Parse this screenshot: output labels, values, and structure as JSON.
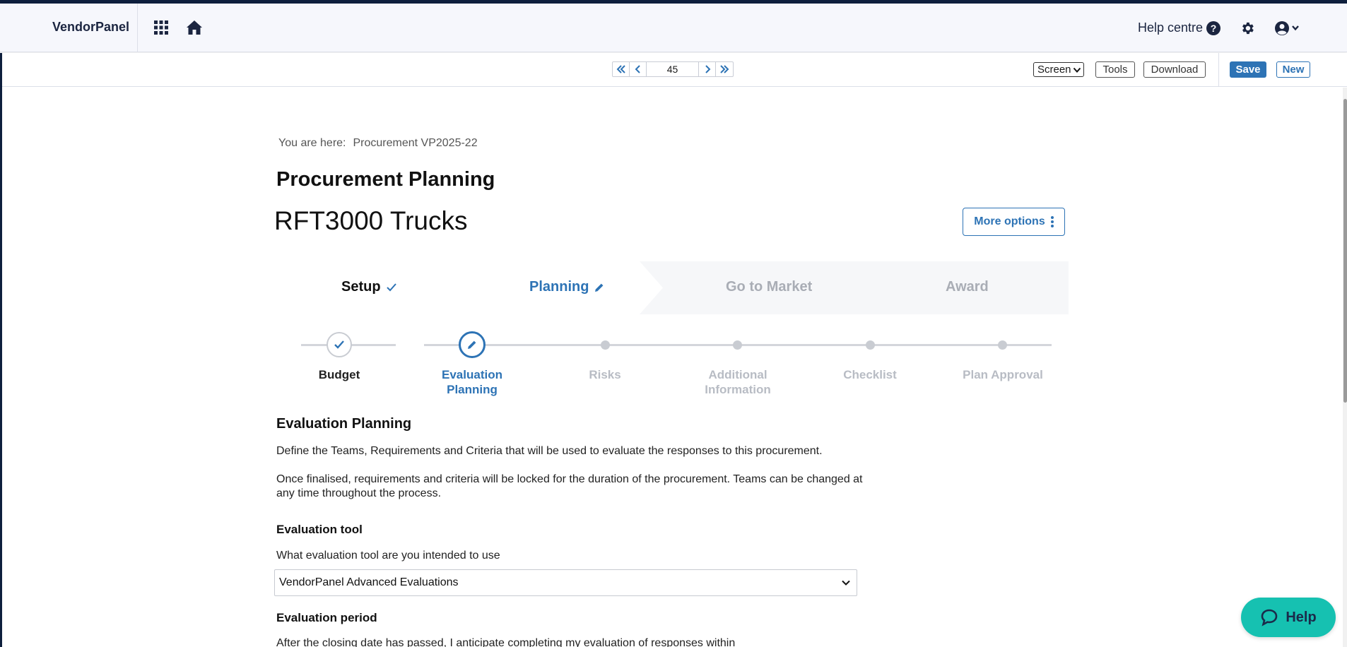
{
  "app": {
    "brand": "VendorPanel",
    "help_centre_label": "Help centre",
    "help_icon_glyph": "?"
  },
  "toolbar": {
    "page_number": "45",
    "screen_select_value": "Screen",
    "tools_label": "Tools",
    "download_label": "Download",
    "save_label": "Save",
    "new_label": "New"
  },
  "breadcrumb": {
    "prefix": "You are here:",
    "items": [
      "Procurement VP2025-22"
    ]
  },
  "page": {
    "title": "Procurement Planning",
    "procurement_name": "RFT3000 Trucks",
    "more_options_label": "More options"
  },
  "phases": [
    {
      "label": "Setup",
      "state": "complete"
    },
    {
      "label": "Planning",
      "state": "active"
    },
    {
      "label": "Go to Market",
      "state": "upcoming"
    },
    {
      "label": "Award",
      "state": "upcoming"
    }
  ],
  "steps": [
    {
      "label": "Budget",
      "state": "complete"
    },
    {
      "label": "Evaluation Planning",
      "label_line1": "Evaluation",
      "label_line2": "Planning",
      "state": "active"
    },
    {
      "label": "Risks",
      "state": "upcoming"
    },
    {
      "label": "Additional Information",
      "label_line1": "Additional",
      "label_line2": "Information",
      "state": "upcoming"
    },
    {
      "label": "Checklist",
      "state": "upcoming"
    },
    {
      "label": "Plan Approval",
      "state": "upcoming"
    }
  ],
  "section": {
    "title": "Evaluation Planning",
    "intro": "Define the Teams, Requirements and Criteria that will be used to evaluate the responses to this procurement.",
    "note": "Once finalised, requirements and criteria will be locked for the duration of the procurement. Teams can be changed at any time throughout the process.",
    "evaluation_tool": {
      "title": "Evaluation tool",
      "question": "What evaluation tool are you intended to use",
      "selected": "VendorPanel Advanced Evaluations"
    },
    "evaluation_period": {
      "title": "Evaluation period",
      "question": "After the closing date has passed, I anticipate completing my evaluation of responses within"
    }
  },
  "help_fab": {
    "label": "Help"
  },
  "colors": {
    "accent": "#2d73b5",
    "navy": "#1b2540",
    "fab": "#16c1b1",
    "muted": "#a9adb5"
  }
}
